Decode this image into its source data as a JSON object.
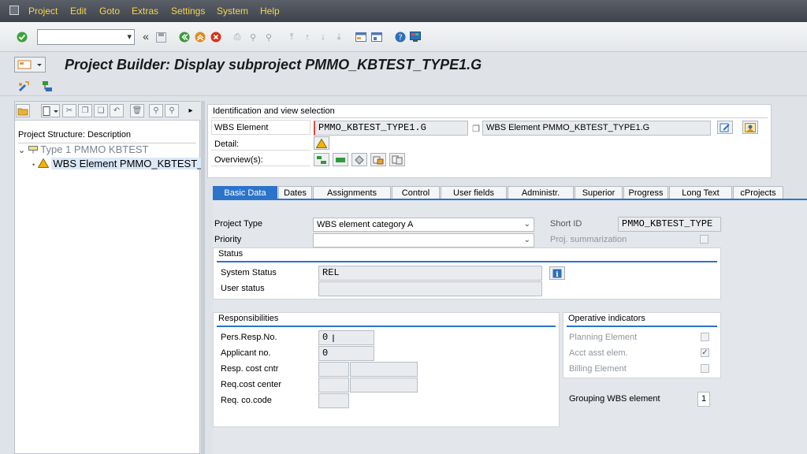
{
  "menu": {
    "items": [
      "Project",
      "Edit",
      "Goto",
      "Extras",
      "Settings",
      "System",
      "Help"
    ]
  },
  "toolbar": {
    "back_chevron": "«"
  },
  "title": "Project Builder: Display subproject PMMO_KBTEST_TYPE1.G",
  "tree": {
    "header": "Project Structure: Description",
    "items": [
      {
        "label": "Type 1 PMMO KBTEST"
      },
      {
        "label": "WBS Element PMMO_KBTEST_"
      }
    ]
  },
  "identification": {
    "section_title": "Identification and view selection",
    "wbs_label": "WBS Element",
    "wbs_value": "PMMO_KBTEST_TYPE1.G",
    "wbs_desc": "WBS Element PMMO_KBTEST_TYPE1.G",
    "detail_label": "Detail:",
    "overview_label": "Overview(s):"
  },
  "tabs": [
    {
      "label": "Basic Data",
      "active": true
    },
    {
      "label": "Dates"
    },
    {
      "label": "Assignments"
    },
    {
      "label": "Control"
    },
    {
      "label": "User fields"
    },
    {
      "label": "Administr."
    },
    {
      "label": "Superior"
    },
    {
      "label": "Progress"
    },
    {
      "label": "Long Text"
    },
    {
      "label": "cProjects"
    }
  ],
  "basic": {
    "project_type_label": "Project Type",
    "project_type_value": "WBS element category A",
    "priority_label": "Priority",
    "priority_value": "",
    "short_id_label": "Short ID",
    "short_id_value": "PMMO_KBTEST_TYPE",
    "proj_summ_label": "Proj. summarization"
  },
  "status": {
    "title": "Status",
    "system_status_label": "System Status",
    "system_status_value": "REL",
    "user_status_label": "User status",
    "user_status_value": ""
  },
  "responsibilities": {
    "title": "Responsibilities",
    "pers_resp_label": "Pers.Resp.No.",
    "pers_resp_value": "0",
    "applicant_label": "Applicant no.",
    "applicant_value": "0",
    "resp_cc_label": "Resp. cost cntr",
    "req_cc_label": "Req.cost center",
    "req_cocode_label": "Req. co.code"
  },
  "operative": {
    "title": "Operative indicators",
    "planning_label": "Planning Element",
    "planning_checked": false,
    "acct_label": "Acct asst elem.",
    "acct_checked": true,
    "billing_label": "Billing Element",
    "billing_checked": false
  },
  "grouping": {
    "label": "Grouping WBS element",
    "value": "1"
  },
  "colors": {
    "accent": "#2c74c9",
    "menu_text": "#f4d44d",
    "warning": "#f2b300"
  }
}
